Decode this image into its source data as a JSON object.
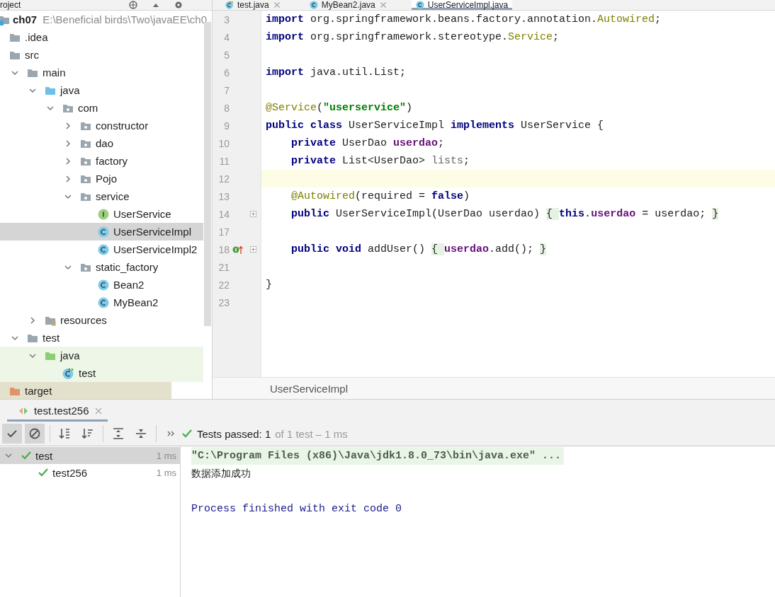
{
  "project": {
    "title": "roject",
    "tree": [
      {
        "label": "ch07",
        "kind": "module",
        "path": "E:\\Beneficial birds\\Two\\javaEE\\ch0",
        "selected": false,
        "children": [
          {
            "label": ".idea",
            "kind": "folder",
            "selected": false
          },
          {
            "label": "src",
            "kind": "folder",
            "selected": false,
            "children": [
              {
                "label": "main",
                "kind": "folder",
                "expanded": true,
                "selected": false,
                "children": [
                  {
                    "label": "java",
                    "kind": "source",
                    "expanded": true,
                    "selected": false,
                    "children": [
                      {
                        "label": "com",
                        "kind": "package",
                        "expanded": true,
                        "selected": false,
                        "children": [
                          {
                            "label": "constructor",
                            "kind": "package",
                            "expanded": false,
                            "selected": false
                          },
                          {
                            "label": "dao",
                            "kind": "package",
                            "expanded": false,
                            "selected": false
                          },
                          {
                            "label": "factory",
                            "kind": "package",
                            "expanded": false,
                            "selected": false
                          },
                          {
                            "label": "Pojo",
                            "kind": "package",
                            "expanded": false,
                            "selected": false
                          },
                          {
                            "label": "service",
                            "kind": "package",
                            "expanded": true,
                            "selected": false,
                            "children": [
                              {
                                "label": "UserService",
                                "kind": "interface",
                                "selected": false
                              },
                              {
                                "label": "UserServiceImpl",
                                "kind": "class",
                                "selected": true
                              },
                              {
                                "label": "UserServiceImpl2",
                                "kind": "class",
                                "selected": false
                              }
                            ]
                          },
                          {
                            "label": "static_factory",
                            "kind": "package",
                            "expanded": true,
                            "selected": false,
                            "children": [
                              {
                                "label": "Bean2",
                                "kind": "class",
                                "selected": false
                              },
                              {
                                "label": "MyBean2",
                                "kind": "class",
                                "selected": false
                              }
                            ]
                          }
                        ]
                      }
                    ]
                  },
                  {
                    "label": "resources",
                    "kind": "resources",
                    "expanded": false,
                    "selected": false
                  }
                ]
              },
              {
                "label": "test",
                "kind": "folder",
                "expanded": true,
                "selected": false,
                "children": [
                  {
                    "label": "java",
                    "kind": "test-source",
                    "expanded": true,
                    "test_sources": true,
                    "selected": false,
                    "children": [
                      {
                        "label": "test",
                        "kind": "test-class",
                        "test_sources": true,
                        "selected": false
                      }
                    ]
                  }
                ]
              }
            ]
          },
          {
            "label": "target",
            "kind": "excluded",
            "excluded": true,
            "selected": false
          }
        ]
      }
    ]
  },
  "editor": {
    "tabs": [
      {
        "label": "test.java",
        "kind": "test-class",
        "selected": false
      },
      {
        "label": "MyBean2.java",
        "kind": "class",
        "selected": false
      },
      {
        "label": "UserServiceImpl.java",
        "kind": "class",
        "selected": true
      }
    ],
    "lines": [
      {
        "number": "3",
        "segments": [
          {
            "kind": "kw",
            "text": "import"
          },
          {
            "kind": "plain",
            "text": " org.springframework.beans.factory.annotation."
          },
          {
            "kind": "ann",
            "text": "Autowired"
          },
          {
            "kind": "plain",
            "text": ";"
          }
        ]
      },
      {
        "number": "4",
        "segments": [
          {
            "kind": "kw",
            "text": "import"
          },
          {
            "kind": "plain",
            "text": " org.springframework.stereotype."
          },
          {
            "kind": "ann",
            "text": "Service"
          },
          {
            "kind": "plain",
            "text": ";"
          }
        ]
      },
      {
        "number": "5"
      },
      {
        "number": "6",
        "segments": [
          {
            "kind": "kw",
            "text": "import"
          },
          {
            "kind": "plain",
            "text": " java.util.List;"
          }
        ]
      },
      {
        "number": "7"
      },
      {
        "number": "8",
        "segments": [
          {
            "kind": "ann",
            "text": "@Service"
          },
          {
            "kind": "plain",
            "text": "("
          },
          {
            "kind": "str",
            "text": "\"userservice\""
          },
          {
            "kind": "plain",
            "text": ")"
          }
        ]
      },
      {
        "number": "9",
        "segments": [
          {
            "kind": "kw",
            "text": "public class"
          },
          {
            "kind": "plain",
            "text": " UserServiceImpl "
          },
          {
            "kind": "kw",
            "text": "implements"
          },
          {
            "kind": "plain",
            "text": " UserService {"
          }
        ]
      },
      {
        "number": "10",
        "segments": [
          {
            "kind": "kw",
            "text": "    private"
          },
          {
            "kind": "plain",
            "text": " UserDao "
          },
          {
            "kind": "field",
            "text": "userdao"
          },
          {
            "kind": "plain",
            "text": ";"
          }
        ]
      },
      {
        "number": "11",
        "segments": [
          {
            "kind": "kw",
            "text": "    private"
          },
          {
            "kind": "plain",
            "text": " List<UserDao> "
          },
          {
            "kind": "unused",
            "text": "lists"
          },
          {
            "kind": "plain",
            "text": ";"
          }
        ]
      },
      {
        "number": "12",
        "current": true
      },
      {
        "number": "13",
        "segments": [
          {
            "kind": "ann",
            "text": "    @Autowired"
          },
          {
            "kind": "plain",
            "text": "(required = "
          },
          {
            "kind": "kw",
            "text": "false"
          },
          {
            "kind": "plain",
            "text": ")"
          }
        ]
      },
      {
        "number": "14",
        "foldable": true,
        "segments": [
          {
            "kind": "kw",
            "text": "    public"
          },
          {
            "kind": "plain",
            "text": " UserServiceImpl(UserDao userdao) "
          },
          {
            "kind": "brace",
            "text": "{ "
          },
          {
            "kind": "kw",
            "text": "this"
          },
          {
            "kind": "plain",
            "text": "."
          },
          {
            "kind": "field",
            "text": "userdao"
          },
          {
            "kind": "plain",
            "text": " = userdao; "
          },
          {
            "kind": "brace",
            "text": "}"
          }
        ]
      },
      {
        "number": "17"
      },
      {
        "number": "18",
        "foldable": true,
        "implements": true,
        "segments": [
          {
            "kind": "kw",
            "text": "    public void"
          },
          {
            "kind": "plain",
            "text": " addUser() "
          },
          {
            "kind": "brace",
            "text": "{ "
          },
          {
            "kind": "field",
            "text": "userdao"
          },
          {
            "kind": "plain",
            "text": ".add(); "
          },
          {
            "kind": "brace",
            "text": "}"
          }
        ]
      },
      {
        "number": "21"
      },
      {
        "number": "22",
        "segments": [
          {
            "kind": "plain",
            "text": "}"
          }
        ]
      },
      {
        "number": "23"
      }
    ],
    "breadcrumb": "UserServiceImpl"
  },
  "run": {
    "tab": "test.test256",
    "toolbar": [
      {
        "kind": "show-passed",
        "on": true
      },
      {
        "kind": "show-ignored",
        "on": true
      },
      {
        "kind": "sort-alpha",
        "on": false
      },
      {
        "kind": "sort-duration",
        "on": false
      },
      {
        "kind": "expand-all",
        "on": false
      },
      {
        "kind": "collapse-all",
        "on": false
      },
      {
        "kind": "more",
        "on": false
      }
    ],
    "status": "Tests passed: 1",
    "status_detail": "of 1 test – 1 ms",
    "results": [
      {
        "label": "test",
        "time": "1 ms",
        "expanded": true,
        "selected": true,
        "children": [
          {
            "label": "test256",
            "time": "1 ms",
            "selected": false
          }
        ]
      }
    ],
    "console": [
      {
        "kind": "command",
        "text": "\"C:\\Program Files (x86)\\Java\\jdk1.8.0_73\\bin\\java.exe\" ..."
      },
      {
        "kind": "output",
        "text": "数据添加成功"
      },
      {
        "kind": "exit",
        "text": "Process finished with exit code 0"
      }
    ]
  }
}
